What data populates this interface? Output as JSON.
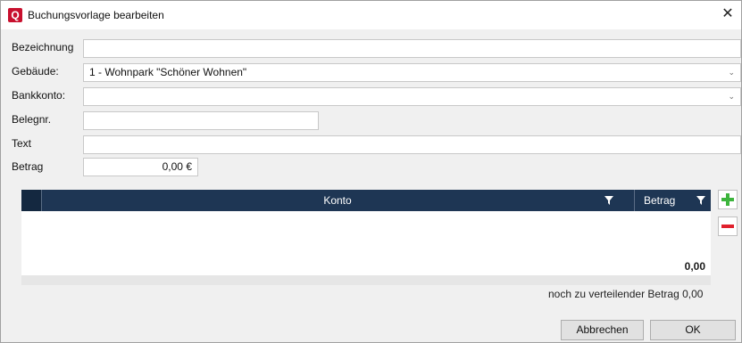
{
  "window": {
    "title": "Buchungsvorlage bearbeiten",
    "logo_letter": "Q",
    "close_glyph": "✕"
  },
  "form": {
    "bezeichnung": {
      "label": "Bezeichnung",
      "value": ""
    },
    "gebaeude": {
      "label": "Gebäude:",
      "value": "1 - Wohnpark \"Schöner Wohnen\""
    },
    "bankkonto": {
      "label": "Bankkonto:",
      "value": ""
    },
    "belegnr": {
      "label": "Belegnr.",
      "value": ""
    },
    "text": {
      "label": "Text",
      "value": ""
    },
    "betrag": {
      "label": "Betrag",
      "value": "0,00 €"
    }
  },
  "grid": {
    "columns": [
      "Konto",
      "Betrag"
    ],
    "rows": [],
    "sum": "0,00"
  },
  "remaining": "noch zu verteilender Betrag 0,00",
  "buttons": {
    "cancel": "Abbrechen",
    "ok": "OK"
  },
  "colors": {
    "accent": "#c8102e",
    "grid_header": "#1e3654",
    "add_icon": "#3cb43c",
    "remove_icon": "#e0202c"
  },
  "icons": [
    "app-logo-icon",
    "close-icon",
    "chevron-down-icon",
    "filter-icon",
    "plus-icon",
    "minus-icon"
  ]
}
